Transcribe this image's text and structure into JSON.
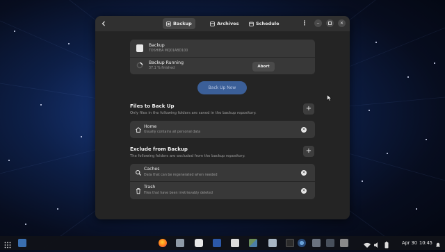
{
  "headerbar": {
    "tabs": [
      {
        "label": "Backup",
        "icon": "backup-icon"
      },
      {
        "label": "Archives",
        "icon": "archive-icon"
      },
      {
        "label": "Schedule",
        "icon": "calendar-icon"
      }
    ],
    "active_tab": "Backup"
  },
  "status": {
    "device_title": "Backup",
    "device_name": "TOSHIBA MQ01ABD100",
    "running_title": "Backup Running",
    "progress_text": "37.1 % finished",
    "progress_fraction": 0.371,
    "abort_label": "Abort"
  },
  "backup_now_label": "Back Up Now",
  "include": {
    "title": "Files to Back Up",
    "description": "Only files in the following folders are saved in the backup repository.",
    "items": [
      {
        "title": "Home",
        "subtitle": "Usually contains all personal data",
        "icon": "home-icon"
      }
    ]
  },
  "exclude": {
    "title": "Exclude from Backup",
    "description": "The following folders are excluded from the backup repository.",
    "items": [
      {
        "title": "Caches",
        "subtitle": "Data that can be regenerated when needed",
        "icon": "search-icon"
      },
      {
        "title": "Trash",
        "subtitle": "Files that have been irretrievably deleted",
        "icon": "trash-icon"
      }
    ]
  },
  "taskbar": {
    "date": "Apr 30",
    "time": "10:45"
  },
  "colors": {
    "window_bg": "#242424",
    "card_bg": "#383838",
    "accent": "#3b5f98",
    "desktop": "#16326f"
  }
}
